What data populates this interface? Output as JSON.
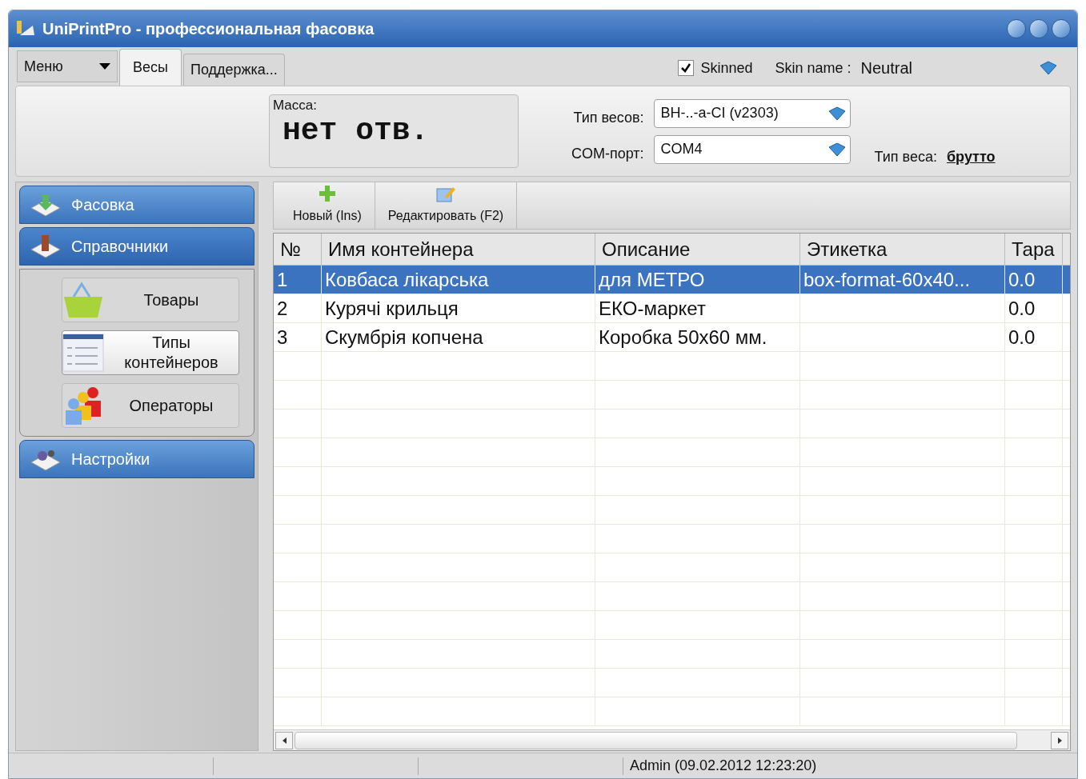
{
  "window": {
    "title": "UniPrintPro - профессиональная фасовка"
  },
  "menu_button": {
    "label": "Меню"
  },
  "tabs": [
    {
      "label": "Весы",
      "selected": true
    },
    {
      "label": "Поддержка...",
      "selected": false
    }
  ],
  "skinned": {
    "label": "Skinned",
    "checked": true
  },
  "skin_name": {
    "label": "Skin name :",
    "value": "Neutral"
  },
  "mass": {
    "label": "Масса:",
    "value": "нет отв."
  },
  "scale_type": {
    "label": "Тип весов:",
    "value": "ВН-..-а-CI (v2303)"
  },
  "com_port": {
    "label": "COM-порт:",
    "value": "COM4"
  },
  "weight_type": {
    "label": "Тип веса:",
    "value": "брутто"
  },
  "sidebar": {
    "groups": [
      {
        "label": "Фасовка",
        "kind": "packing",
        "expanded": false
      },
      {
        "label": "Справочники",
        "kind": "books",
        "expanded": true,
        "items": [
          {
            "label": "Товары",
            "kind": "basket",
            "selected": false
          },
          {
            "label": "Типы контейнеров",
            "kind": "list",
            "selected": true
          },
          {
            "label": "Операторы",
            "kind": "people",
            "selected": false
          }
        ]
      },
      {
        "label": "Настройки",
        "kind": "settings",
        "expanded": false
      }
    ]
  },
  "toolbar": [
    {
      "label": "Новый (Ins)",
      "kind": "add"
    },
    {
      "label": "Редактировать (F2)",
      "kind": "edit"
    }
  ],
  "table": {
    "columns": [
      "№",
      "Имя контейнера",
      "Описание",
      "Этикетка",
      "Тара"
    ],
    "rows": [
      {
        "cells": [
          "1",
          "Ковбаса лікарська",
          "для МЕТРО",
          "box-format-60x40...",
          "0.0"
        ],
        "selected": true
      },
      {
        "cells": [
          "2",
          "Курячі крильця",
          "ЕКО-маркет",
          "",
          "0.0"
        ],
        "selected": false
      },
      {
        "cells": [
          "3",
          "Скумбрія копчена",
          "Коробка 50х60 мм.",
          "",
          "0.0"
        ],
        "selected": false
      }
    ]
  },
  "status_bar": {
    "user": "Admin (09.02.2012 12:23:20)"
  }
}
